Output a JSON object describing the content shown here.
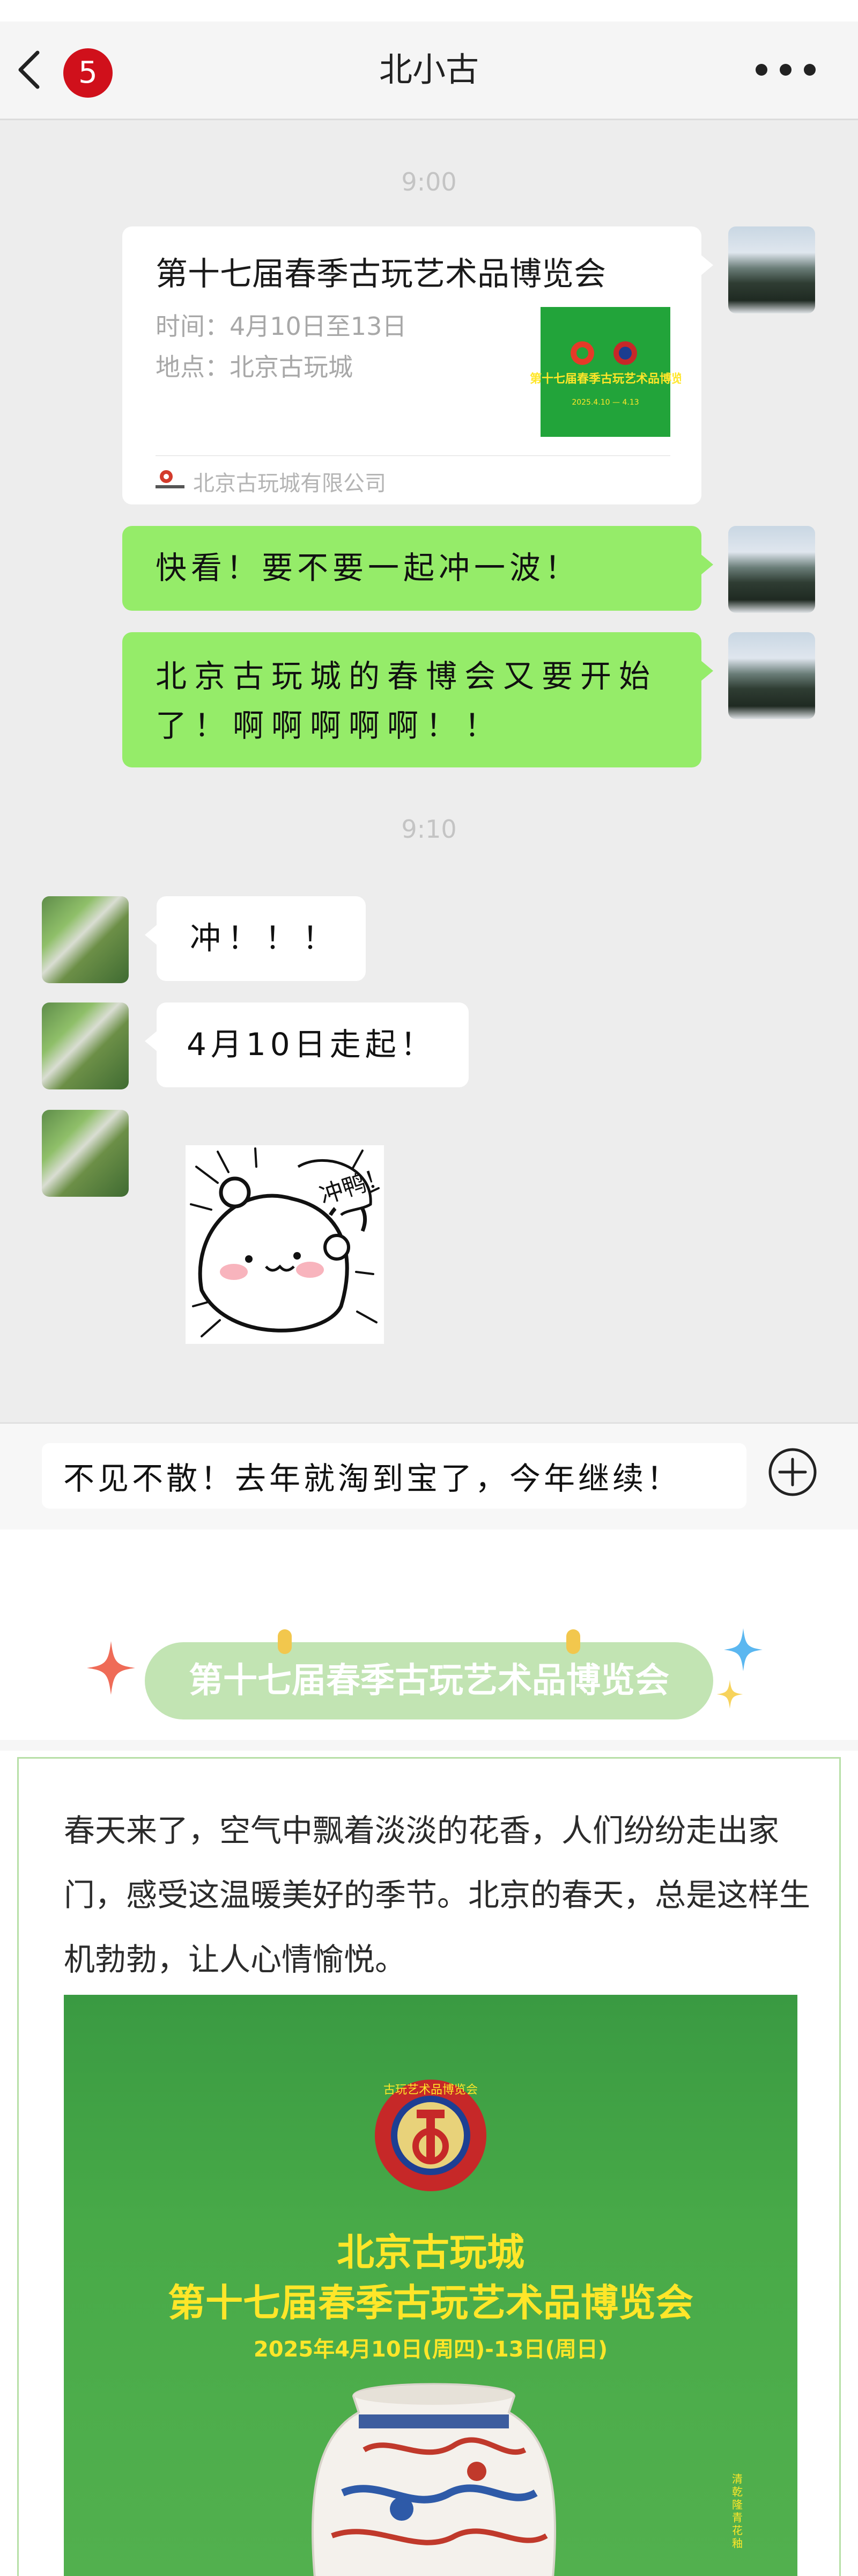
{
  "header": {
    "title": "北小古",
    "unread_count": "5",
    "back_icon": "chevron-left-icon",
    "more_icon": "more-dots-icon"
  },
  "messages": {
    "time_1": "9:00",
    "share_card": {
      "title": "第十七届春季古玩艺术品博览会",
      "time_line": "时间：4月10日至13日",
      "place_line": "地点：北京古玩城",
      "source": "北京古玩城有限公司",
      "thumb_text": "第十七届春季古玩艺术品博览会",
      "thumb_date": "2025.4.10 — 4.13"
    },
    "sent_1": "快看！要不要一起冲一波！",
    "sent_2": "北京古玩城的春博会又要开始了！啊啊啊啊啊！！",
    "time_2": "9:10",
    "reply_1": "冲！！！",
    "reply_2": "4月10日走起！",
    "sticker_text": "冲鸭！"
  },
  "input": {
    "value": "不见不散！去年就淘到宝了，今年继续！",
    "add_icon": "plus-circle-icon"
  },
  "article": {
    "banner_title": "第十七届春季古玩艺术品博览会",
    "paragraph": "春天来了，空气中飘着淡淡的花香，人们纷纷走出家门，感受这温暖美好的季节。北京的春天，总是这样生机勃勃，让人心情愉悦。",
    "poster": {
      "seal_text": "古玩艺术品博览会",
      "org": "北京古玩城",
      "title": "第十七届春季古玩艺术品博览会",
      "date": "2025年4月10日(周四)-13日(周日)",
      "side_text": "清乾隆 青花釉"
    }
  },
  "colors": {
    "bubble_green": "#95ec69",
    "badge_red": "#d0101b",
    "poster_green": "#48aa48",
    "poster_yellow": "#ffe629",
    "banner_green": "#c2e4b3"
  }
}
